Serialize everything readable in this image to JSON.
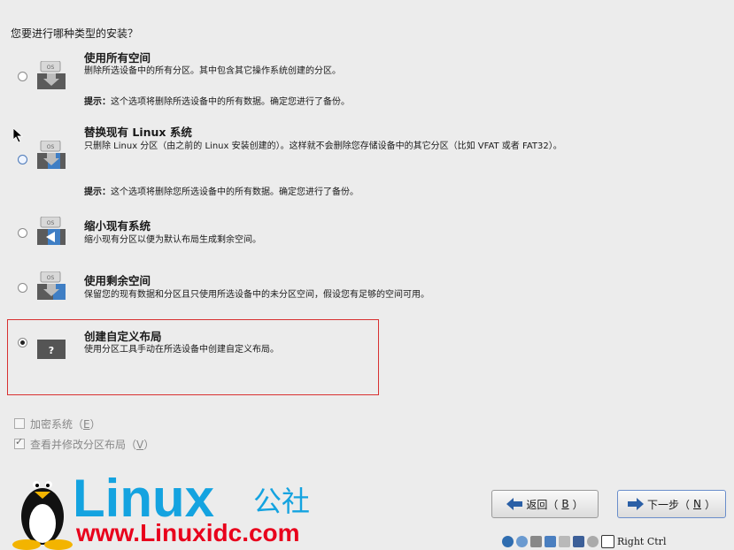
{
  "question": "您要进行哪种类型的安装？",
  "options": [
    {
      "title": "使用所有空间",
      "desc": "删除所选设备中的所有分区。其中包含其它操作系统创建的分区。",
      "tip_label": "提示：",
      "tip": "这个选项将删除所选设备中的所有数据。确定您进行了备份。",
      "selected": false
    },
    {
      "title": "替换现有 Linux 系统",
      "desc": "只删除 Linux 分区（由之前的 Linux 安装创建的）。这样就不会删除您存储设备中的其它分区（比如 VFAT 或者 FAT32）。",
      "tip_label": "提示：",
      "tip": "这个选项将删除您所选设备中的所有数据。确定您进行了备份。",
      "selected": false
    },
    {
      "title": "缩小现有系统",
      "desc": "缩小现有分区以便为默认布局生成剩余空间。",
      "selected": false
    },
    {
      "title": "使用剩余空间",
      "desc": "保留您的现有数据和分区且只使用所选设备中的未分区空间，假设您有足够的空间可用。",
      "selected": false
    },
    {
      "title": "创建自定义布局",
      "desc": "使用分区工具手动在所选设备中创建自定义布局。",
      "selected": true
    }
  ],
  "disk_label": "OS",
  "custom_disk_glyph": "?",
  "checkboxes": [
    {
      "label": "加密系统（",
      "key": "E",
      "end": "）",
      "checked": false,
      "enabled": false
    },
    {
      "label": "查看并修改分区布局（",
      "key": "V",
      "end": "）",
      "checked": true,
      "enabled": false
    }
  ],
  "buttons": {
    "back": {
      "label": "返回（",
      "key": "B",
      "end": "）"
    },
    "next": {
      "label": "下一步（",
      "key": "N",
      "end": "）"
    }
  },
  "logo": {
    "word": "Linux",
    "suffix": "公社",
    "url": "www.Linuxidc.com"
  },
  "tray": {
    "host_key": "Right Ctrl"
  },
  "colors": {
    "accent_blue": "#14a3e0",
    "selection_border": "#d83030",
    "url_red": "#e8001c"
  }
}
